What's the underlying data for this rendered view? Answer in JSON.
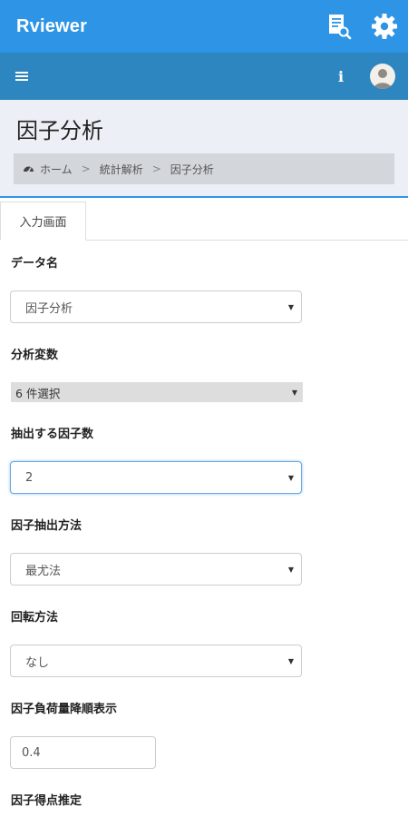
{
  "app": {
    "title": "Rviewer"
  },
  "page": {
    "title": "因子分析"
  },
  "breadcrumb": {
    "home": "ホーム",
    "separator": ">",
    "section": "統計解析",
    "current": "因子分析"
  },
  "tabs": [
    {
      "label": "入力画面"
    }
  ],
  "form": {
    "data_name": {
      "label": "データ名",
      "value": "因子分析"
    },
    "variables": {
      "label": "分析変数",
      "value": "6 件選択"
    },
    "num_factors": {
      "label": "抽出する因子数",
      "value": "2"
    },
    "extraction_method": {
      "label": "因子抽出方法",
      "value": "最尤法"
    },
    "rotation": {
      "label": "回転方法",
      "value": "なし"
    },
    "loading_sort": {
      "label": "因子負荷量降順表示",
      "value": "0.4"
    },
    "score_estimation": {
      "label": "因子得点推定"
    }
  },
  "colors": {
    "topbar": "#2e95e6",
    "navbar": "#2d86bf",
    "header_bg": "#ecf0f6"
  },
  "icons": {
    "report": "report-search-icon",
    "settings": "gear-icon",
    "menu": "hamburger-menu-icon",
    "info": "info-icon",
    "avatar": "user-avatar-icon"
  }
}
